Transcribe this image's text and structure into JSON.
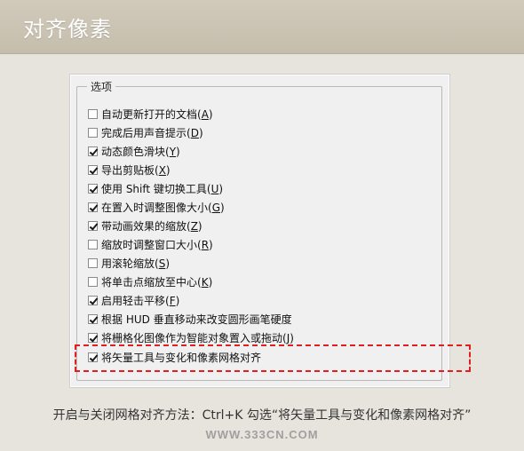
{
  "header": {
    "title": "对齐像素"
  },
  "group": {
    "label": "选项"
  },
  "options": [
    {
      "label": "自动更新打开的文档(",
      "key": "A",
      "end": ")",
      "checked": false
    },
    {
      "label": "完成后用声音提示(",
      "key": "D",
      "end": ")",
      "checked": false
    },
    {
      "label": "动态颜色滑块(",
      "key": "Y",
      "end": ")",
      "checked": true
    },
    {
      "label": "导出剪贴板(",
      "key": "X",
      "end": ")",
      "checked": true
    },
    {
      "label": "使用 Shift 键切换工具(",
      "key": "U",
      "end": ")",
      "checked": true
    },
    {
      "label": "在置入时调整图像大小(",
      "key": "G",
      "end": ")",
      "checked": true
    },
    {
      "label": "带动画效果的缩放(",
      "key": "Z",
      "end": ")",
      "checked": true
    },
    {
      "label": "缩放时调整窗口大小(",
      "key": "R",
      "end": ")",
      "checked": false
    },
    {
      "label": "用滚轮缩放(",
      "key": "S",
      "end": ")",
      "checked": false
    },
    {
      "label": "将单击点缩放至中心(",
      "key": "K",
      "end": ")",
      "checked": false
    },
    {
      "label": "启用轻击平移(",
      "key": "F",
      "end": ")",
      "checked": true
    },
    {
      "label": "根据 HUD 垂直移动来改变圆形画笔硬度",
      "key": "",
      "end": "",
      "checked": true
    },
    {
      "label": "将栅格化图像作为智能对象置入或拖动(",
      "key": "J",
      "end": ")",
      "checked": true
    },
    {
      "label": "将矢量工具与变化和像素网格对齐",
      "key": "",
      "end": "",
      "checked": true
    }
  ],
  "caption": "开启与关闭网格对齐方法：Ctrl+K 勾选“将矢量工具与变化和像素网格对齐”",
  "watermark": "WWW.333CN.COM",
  "colors": {
    "header_bg": "#c9c1b1",
    "highlight_border": "#e02020"
  }
}
